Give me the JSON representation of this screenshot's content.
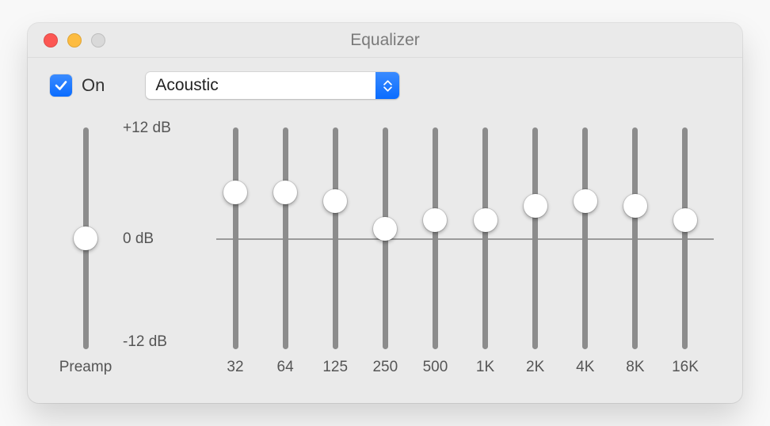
{
  "window": {
    "title": "Equalizer"
  },
  "toggle": {
    "on_label": "On",
    "checked": true
  },
  "preset": {
    "selected": "Acoustic"
  },
  "scale": {
    "max_label": "+12 dB",
    "mid_label": "0 dB",
    "min_label": "-12 dB",
    "min": -12,
    "max": 12
  },
  "preamp": {
    "label": "Preamp",
    "value_db": 0
  },
  "bands": [
    {
      "freq_label": "32",
      "value_db": 5
    },
    {
      "freq_label": "64",
      "value_db": 5
    },
    {
      "freq_label": "125",
      "value_db": 4
    },
    {
      "freq_label": "250",
      "value_db": 1
    },
    {
      "freq_label": "500",
      "value_db": 2
    },
    {
      "freq_label": "1K",
      "value_db": 2
    },
    {
      "freq_label": "2K",
      "value_db": 3.5
    },
    {
      "freq_label": "4K",
      "value_db": 4
    },
    {
      "freq_label": "8K",
      "value_db": 3.5
    },
    {
      "freq_label": "16K",
      "value_db": 2
    }
  ]
}
